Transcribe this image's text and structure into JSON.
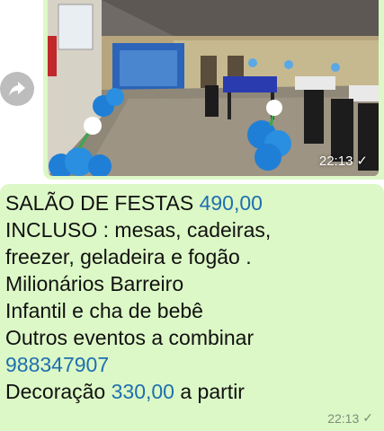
{
  "message": {
    "image_time": "22:13",
    "image_tick": "✓",
    "lines": {
      "l1_text": "SALÃO  DE FESTAS ",
      "l1_price": "490,00",
      "l2": "INCLUSO : mesas, cadeiras,",
      "l3": "freezer, geladeira e fogão .",
      "l4": "Milionários Barreiro",
      "l5": "Infantil e cha de bebê",
      "l6": "Outros eventos  a combinar",
      "l7_phone": "988347907",
      "l8_text": "Decoração ",
      "l8_price": "330,00",
      "l8_suffix": " a partir"
    },
    "text_time": "22:13",
    "text_tick": "✓"
  },
  "colors": {
    "bubble": "#dcf8c6",
    "link": "#1e6fb0",
    "forward_button": "#bdbdbd"
  }
}
